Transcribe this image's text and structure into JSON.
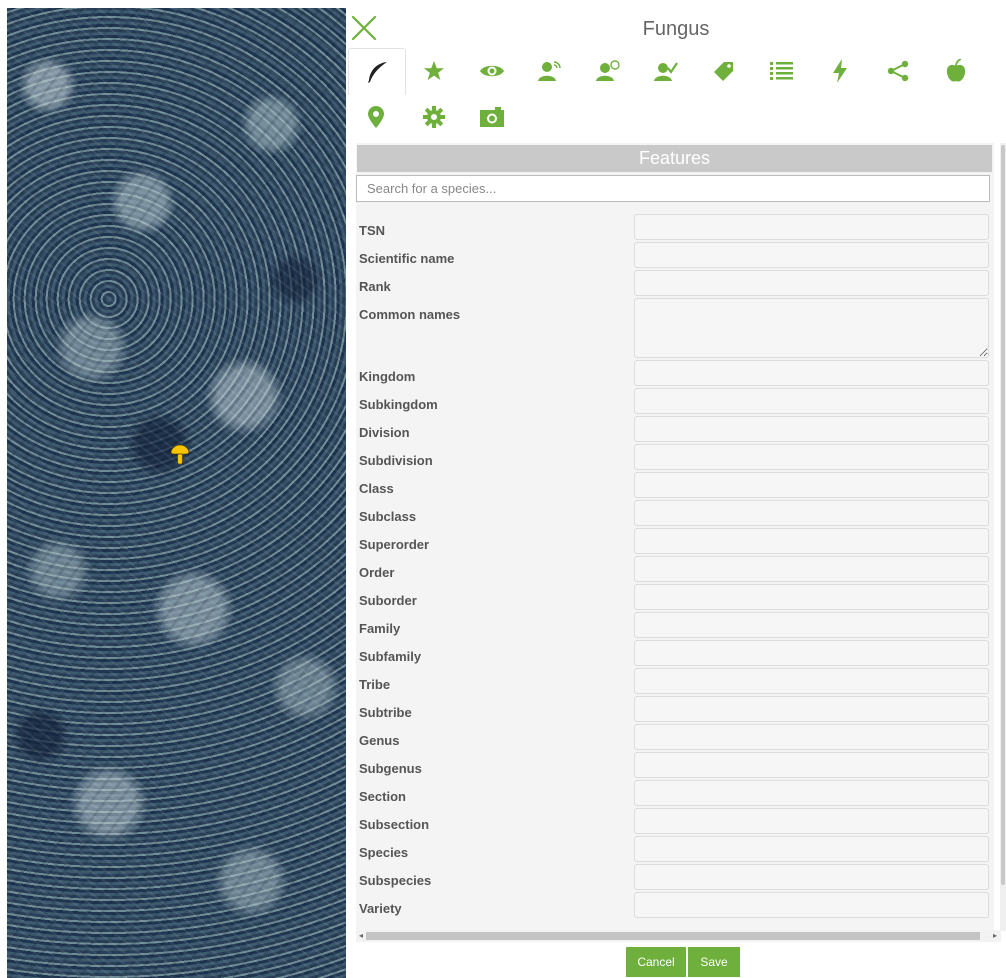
{
  "panel": {
    "title": "Fungus"
  },
  "toolbar": {
    "accent": "#6fb03c",
    "icons": [
      "feather-icon",
      "star-icon",
      "eye-icon",
      "user-wifi-icon",
      "user-clock-icon",
      "user-check-icon",
      "tag-icon",
      "list-icon",
      "bolt-icon",
      "share-icon",
      "apple-icon",
      "map-pin-icon",
      "gear-icon",
      "camera-icon"
    ]
  },
  "features": {
    "header": "Features",
    "search_placeholder": "Search for a species...",
    "fields": [
      {
        "label": "TSN"
      },
      {
        "label": "Scientific name"
      },
      {
        "label": "Rank"
      },
      {
        "label": "Common names",
        "multiline": true
      },
      {
        "label": "Kingdom"
      },
      {
        "label": "Subkingdom"
      },
      {
        "label": "Division"
      },
      {
        "label": "Subdivision"
      },
      {
        "label": "Class"
      },
      {
        "label": "Subclass"
      },
      {
        "label": "Superorder"
      },
      {
        "label": "Order"
      },
      {
        "label": "Suborder"
      },
      {
        "label": "Family"
      },
      {
        "label": "Subfamily"
      },
      {
        "label": "Tribe"
      },
      {
        "label": "Subtribe"
      },
      {
        "label": "Genus"
      },
      {
        "label": "Subgenus"
      },
      {
        "label": "Section"
      },
      {
        "label": "Subsection"
      },
      {
        "label": "Species"
      },
      {
        "label": "Subspecies"
      },
      {
        "label": "Variety"
      }
    ]
  },
  "actions": {
    "cancel": "Cancel",
    "save": "Save"
  }
}
